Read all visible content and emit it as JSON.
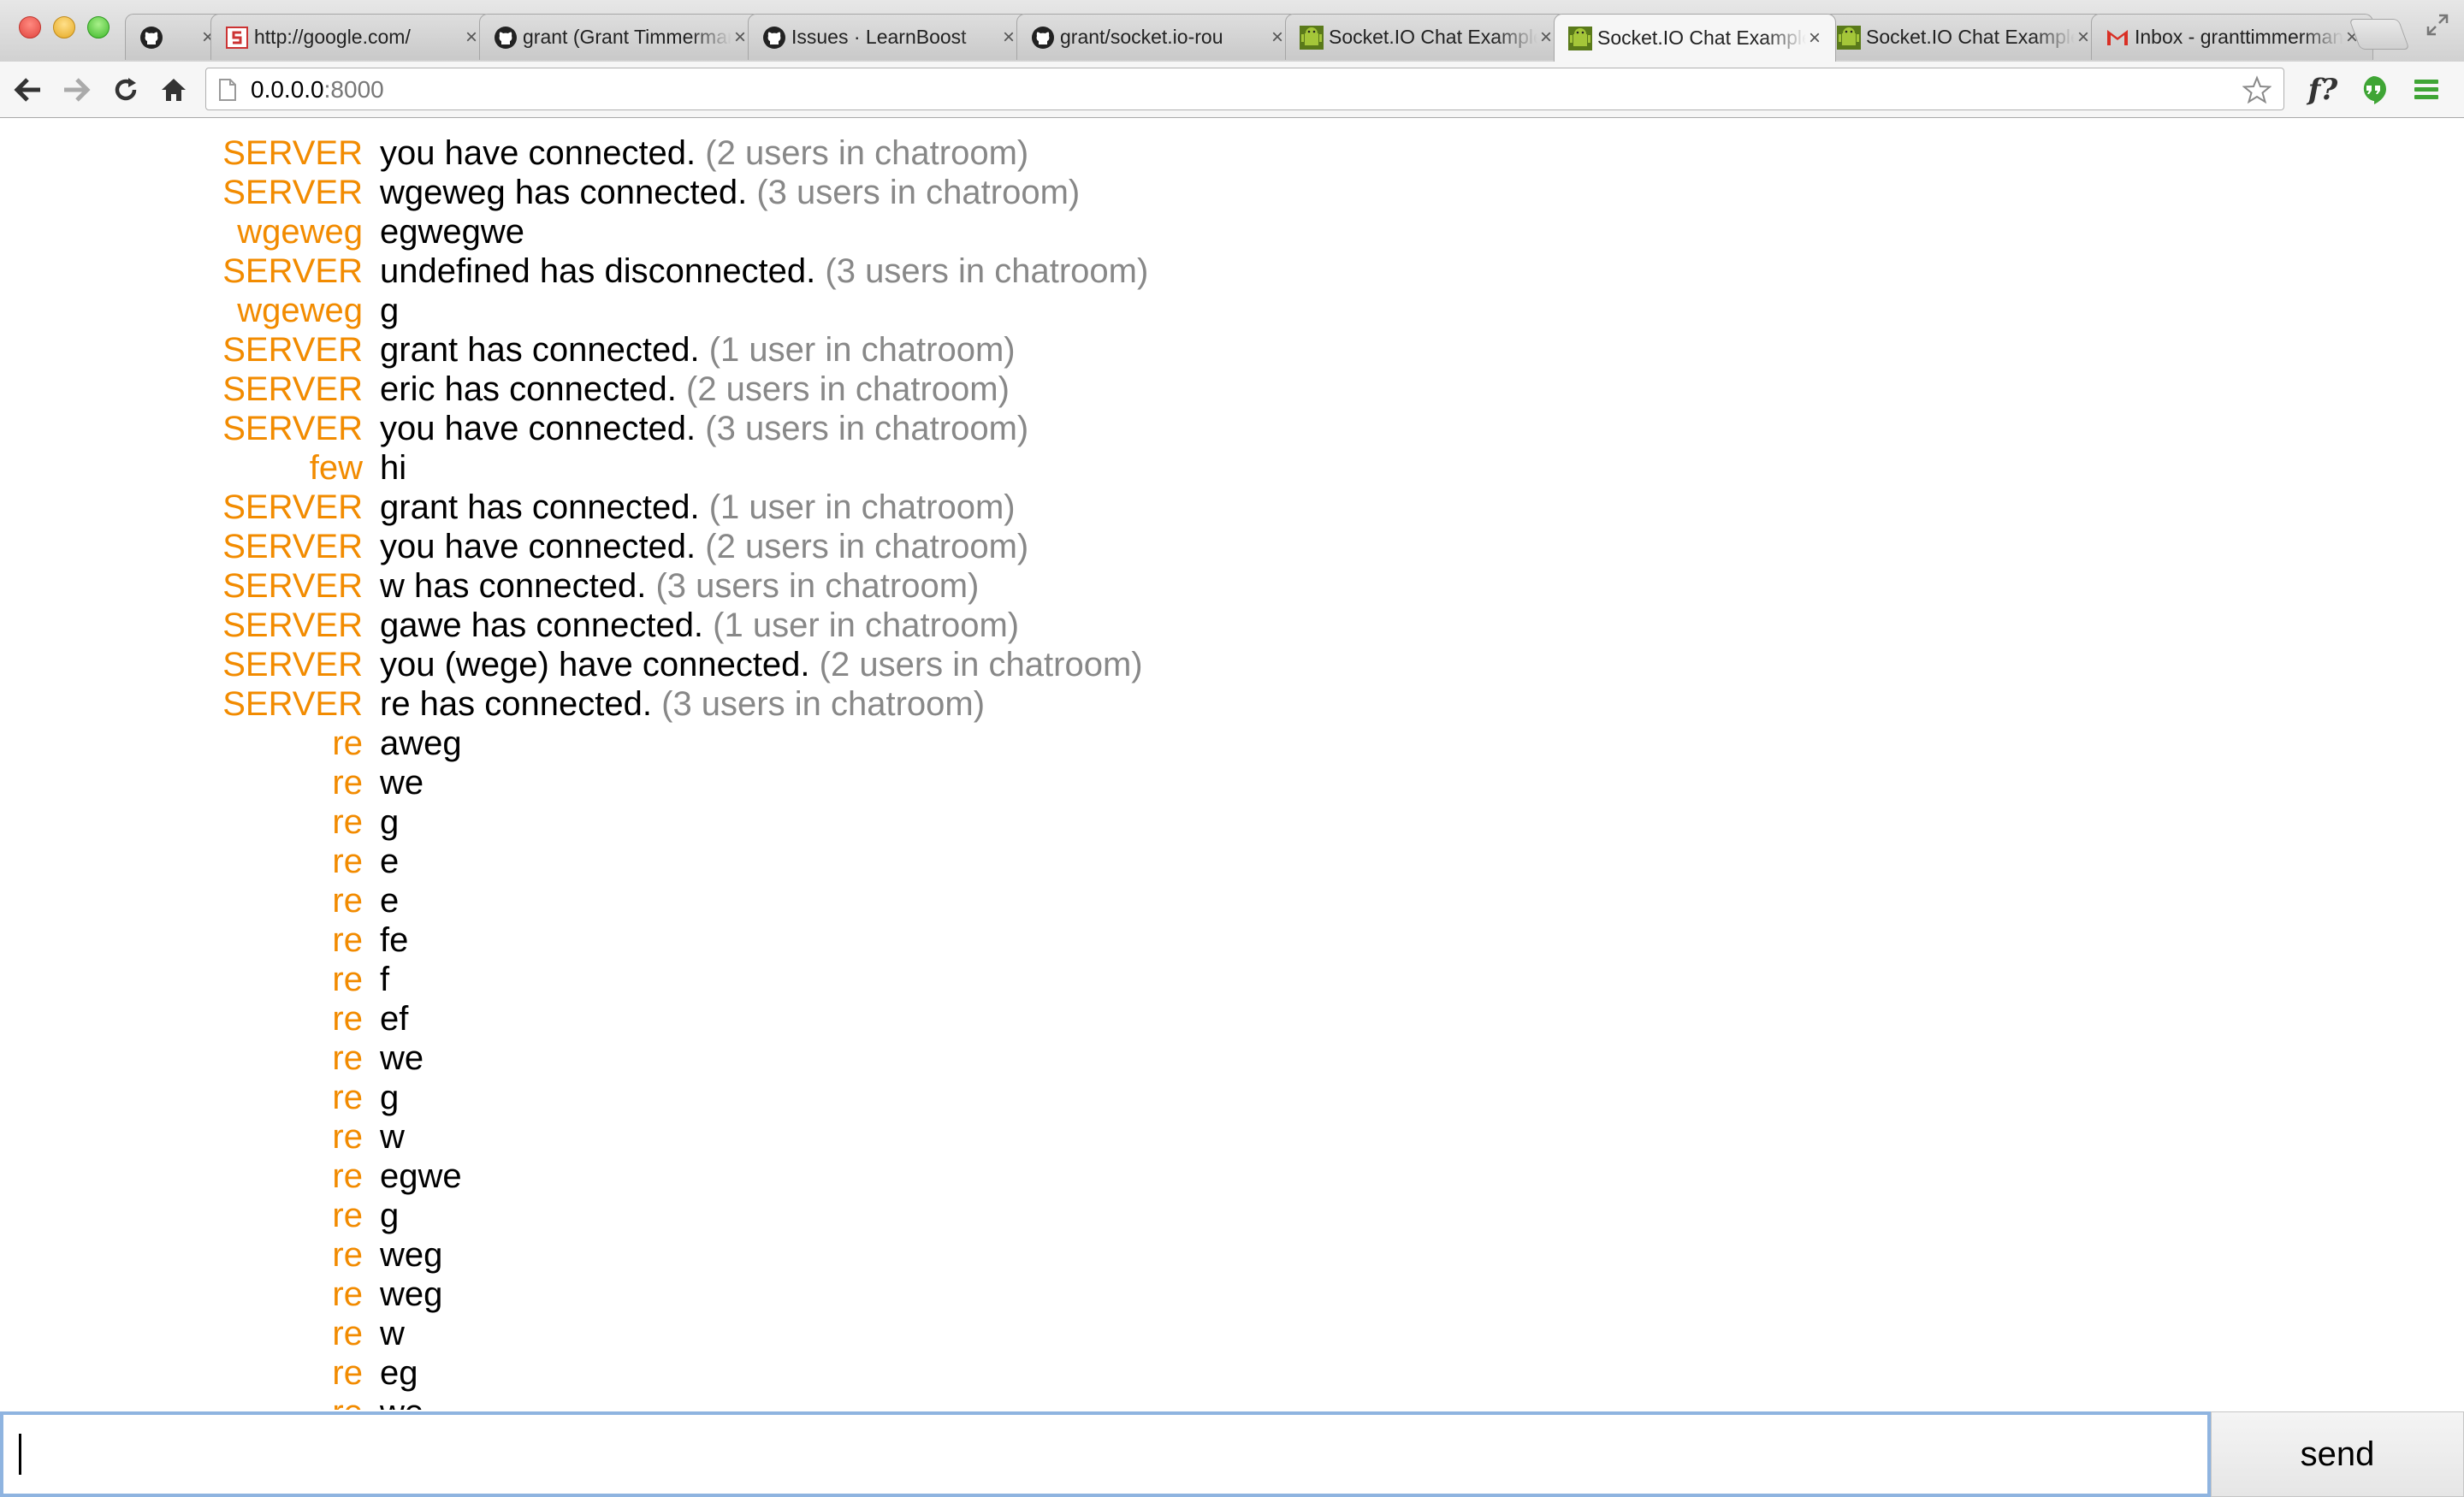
{
  "browser": {
    "tabs": [
      {
        "title": "",
        "icon": "github-icon",
        "active": false
      },
      {
        "title": "http://google.com/",
        "icon": "scribd-icon",
        "active": false
      },
      {
        "title": "grant (Grant Timmerman)",
        "icon": "github-icon",
        "active": false
      },
      {
        "title": "Issues · LearnBoost",
        "icon": "github-icon",
        "active": false
      },
      {
        "title": "grant/socket.io-rou",
        "icon": "github-icon",
        "active": false
      },
      {
        "title": "Socket.IO Chat Example",
        "icon": "android-icon",
        "active": false
      },
      {
        "title": "Socket.IO Chat Example",
        "icon": "android-icon",
        "active": true
      },
      {
        "title": "Socket.IO Chat Example",
        "icon": "android-icon",
        "active": false
      },
      {
        "title": "Inbox - granttimmerman",
        "icon": "gmail-icon",
        "active": false
      }
    ],
    "close_glyph": "×",
    "url_host": "0.0.0.0",
    "url_port": ":8000"
  },
  "toolbar": {
    "ext_label": "f?"
  },
  "chat": {
    "messages": [
      {
        "user": "SERVER",
        "text": "you have connected.",
        "status": "(2 users in chatroom)"
      },
      {
        "user": "SERVER",
        "text": "wgeweg has connected.",
        "status": "(3 users in chatroom)"
      },
      {
        "user": "wgeweg",
        "text": "egwegwe",
        "status": ""
      },
      {
        "user": "SERVER",
        "text": "undefined has disconnected.",
        "status": "(3 users in chatroom)"
      },
      {
        "user": "wgeweg",
        "text": "g",
        "status": ""
      },
      {
        "user": "SERVER",
        "text": "grant has connected.",
        "status": "(1 user in chatroom)"
      },
      {
        "user": "SERVER",
        "text": "eric has connected.",
        "status": "(2 users in chatroom)"
      },
      {
        "user": "SERVER",
        "text": "you have connected.",
        "status": "(3 users in chatroom)"
      },
      {
        "user": "few",
        "text": "hi",
        "status": ""
      },
      {
        "user": "SERVER",
        "text": "grant has connected.",
        "status": "(1 user in chatroom)"
      },
      {
        "user": "SERVER",
        "text": "you have connected.",
        "status": "(2 users in chatroom)"
      },
      {
        "user": "SERVER",
        "text": "w has connected.",
        "status": "(3 users in chatroom)"
      },
      {
        "user": "SERVER",
        "text": "gawe has connected.",
        "status": "(1 user in chatroom)"
      },
      {
        "user": "SERVER",
        "text": "you (wege) have connected.",
        "status": "(2 users in chatroom)"
      },
      {
        "user": "SERVER",
        "text": "re has connected.",
        "status": "(3 users in chatroom)"
      },
      {
        "user": "re",
        "text": "aweg",
        "status": ""
      },
      {
        "user": "re",
        "text": "we",
        "status": ""
      },
      {
        "user": "re",
        "text": "g",
        "status": ""
      },
      {
        "user": "re",
        "text": "e",
        "status": ""
      },
      {
        "user": "re",
        "text": "e",
        "status": ""
      },
      {
        "user": "re",
        "text": "fe",
        "status": ""
      },
      {
        "user": "re",
        "text": "f",
        "status": ""
      },
      {
        "user": "re",
        "text": "ef",
        "status": ""
      },
      {
        "user": "re",
        "text": "we",
        "status": ""
      },
      {
        "user": "re",
        "text": "g",
        "status": ""
      },
      {
        "user": "re",
        "text": "w",
        "status": ""
      },
      {
        "user": "re",
        "text": "egwe",
        "status": ""
      },
      {
        "user": "re",
        "text": "g",
        "status": ""
      },
      {
        "user": "re",
        "text": "weg",
        "status": ""
      },
      {
        "user": "re",
        "text": "weg",
        "status": ""
      },
      {
        "user": "re",
        "text": "w",
        "status": ""
      },
      {
        "user": "re",
        "text": "eg",
        "status": ""
      },
      {
        "user": "re",
        "text": "we",
        "status": ""
      }
    ],
    "input_value": "",
    "send_label": "send",
    "colors": {
      "username": "#f28b00",
      "status": "#888888",
      "text": "#000000"
    }
  }
}
